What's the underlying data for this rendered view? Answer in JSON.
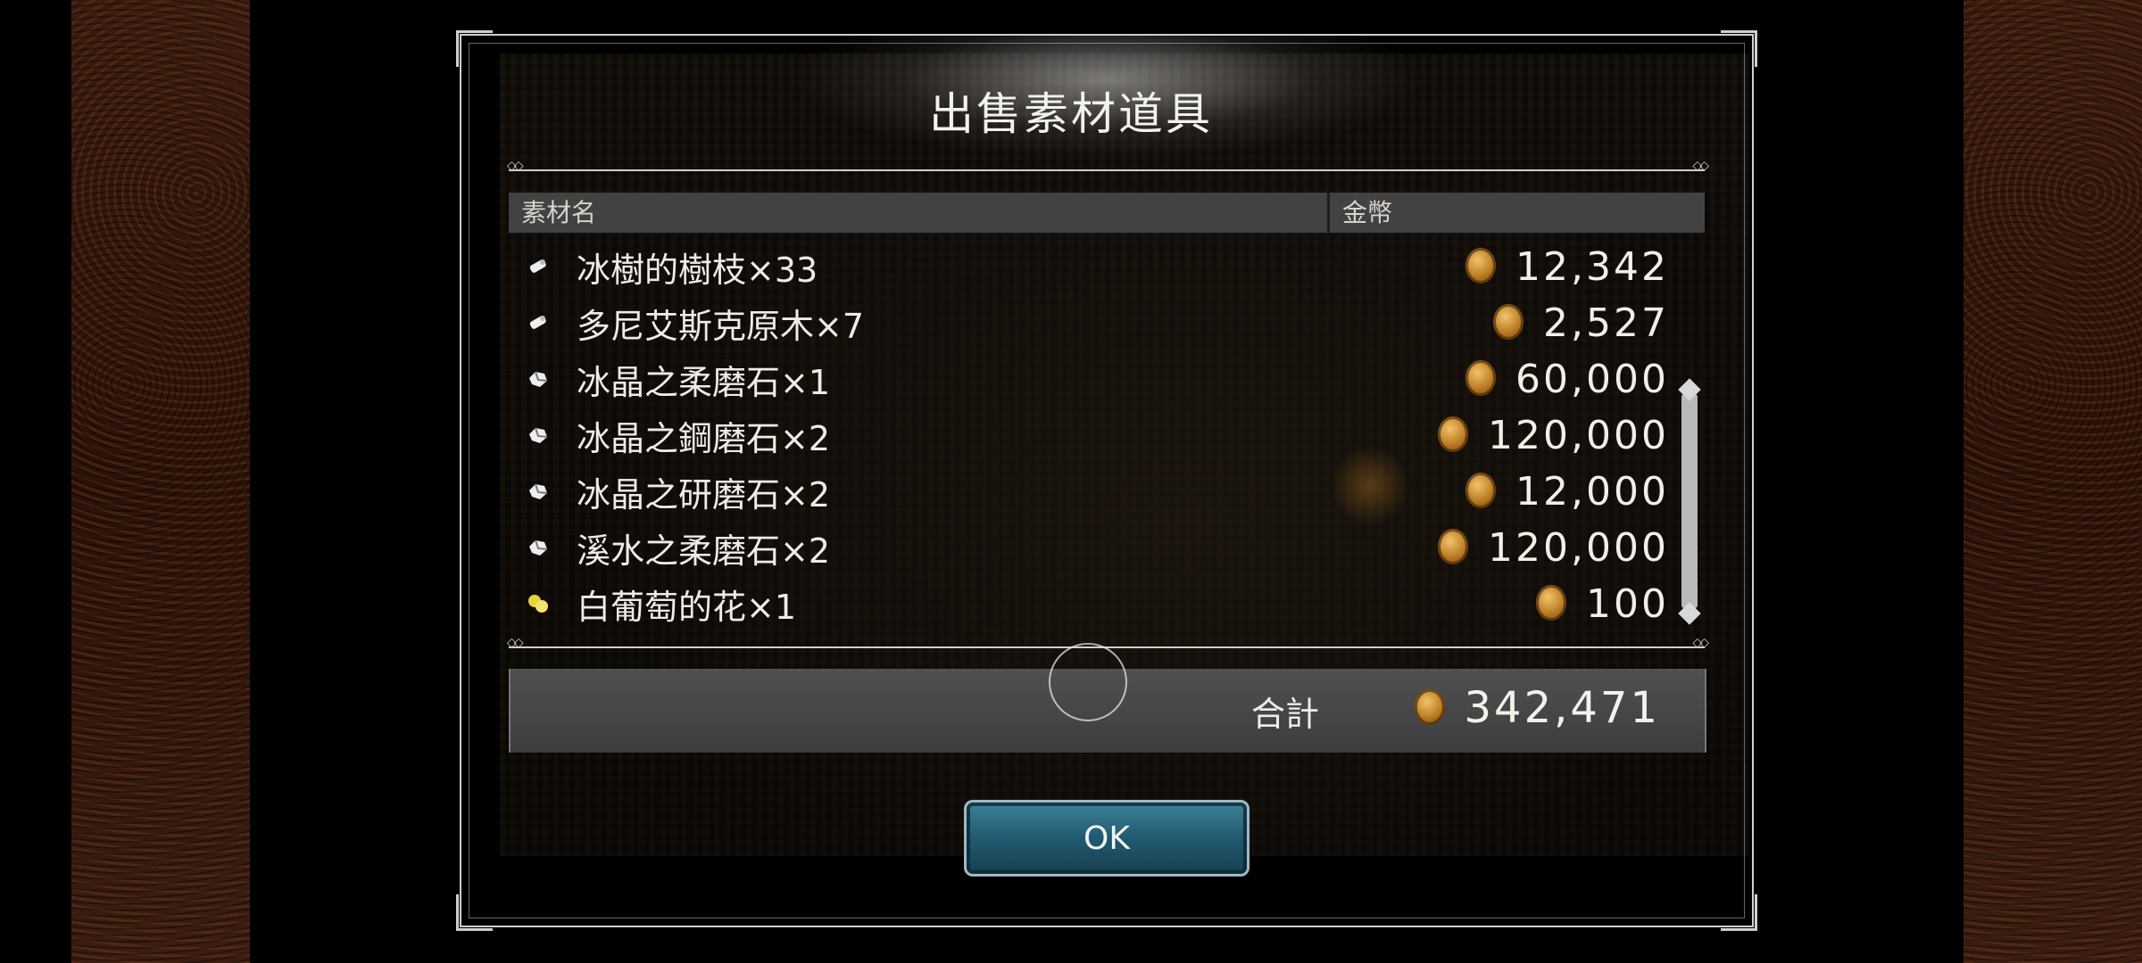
{
  "dialog": {
    "title": "出售素材道具",
    "columns": {
      "name": "素材名",
      "gold": "金幣"
    },
    "items": [
      {
        "icon": "wood-icon",
        "name": "冰樹的樹枝×33",
        "price": "12,342"
      },
      {
        "icon": "wood-icon",
        "name": "多尼艾斯克原木×7",
        "price": "2,527"
      },
      {
        "icon": "ore-icon",
        "name": "冰晶之柔磨石×1",
        "price": "60,000"
      },
      {
        "icon": "ore-icon",
        "name": "冰晶之鋼磨石×2",
        "price": "120,000"
      },
      {
        "icon": "ore-icon",
        "name": "冰晶之研磨石×2",
        "price": "12,000"
      },
      {
        "icon": "ore-icon",
        "name": "溪水之柔磨石×2",
        "price": "120,000"
      },
      {
        "icon": "flower-icon",
        "name": "白葡萄的花×1",
        "price": "100"
      }
    ],
    "total_label": "合計",
    "total_value": "342,471",
    "ok_label": "OK"
  },
  "colors": {
    "ok_button": "#205a70",
    "header_bar": "#424242",
    "coin": "#c58a2c"
  }
}
